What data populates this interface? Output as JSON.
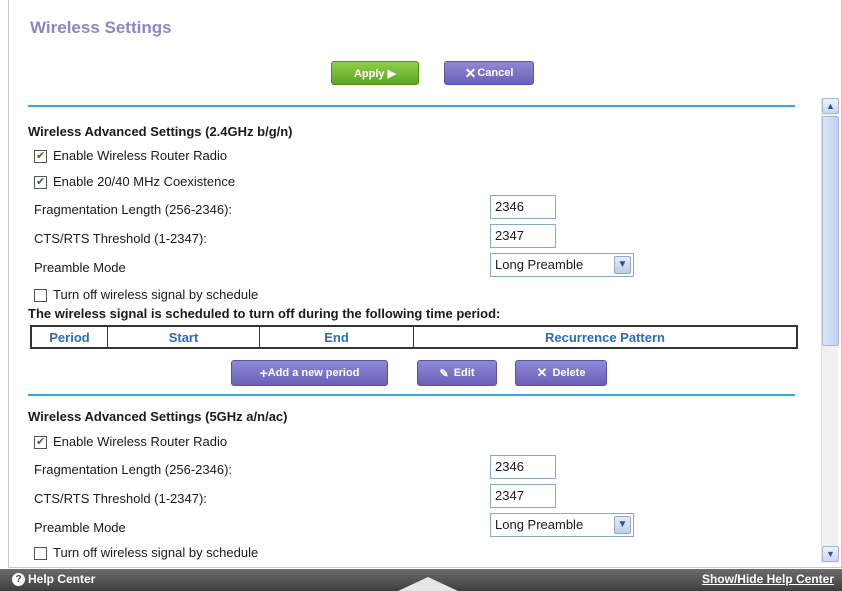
{
  "page": {
    "title": "Wireless Settings"
  },
  "toolbar": {
    "apply_label": "Apply ▶",
    "cancel_label": "Cancel"
  },
  "band24": {
    "title": "Wireless Advanced Settings (2.4GHz b/g/n)",
    "enable_radio": {
      "label": "Enable Wireless Router Radio",
      "checked": true
    },
    "coexistence": {
      "label": "Enable 20/40 MHz Coexistence",
      "checked": true
    },
    "frag": {
      "label": "Fragmentation Length (256-2346):",
      "value": "2346"
    },
    "cts": {
      "label": "CTS/RTS Threshold (1-2347):",
      "value": "2347"
    },
    "preamble": {
      "label": "Preamble Mode",
      "value": "Long Preamble"
    },
    "schedule": {
      "label": "Turn off wireless signal by schedule",
      "checked": false
    },
    "schedule_note": "The wireless signal is scheduled to turn off during the following time period:",
    "table_headers": [
      "Period",
      "Start",
      "End",
      "Recurrence Pattern"
    ],
    "add_period_label": "Add a new period",
    "edit_label": "Edit",
    "delete_label": "Delete"
  },
  "band5": {
    "title": "Wireless Advanced Settings (5GHz a/n/ac)",
    "enable_radio": {
      "label": "Enable Wireless Router Radio",
      "checked": true
    },
    "frag": {
      "label": "Fragmentation Length (256-2346):",
      "value": "2346"
    },
    "cts": {
      "label": "CTS/RTS Threshold (1-2347):",
      "value": "2347"
    },
    "preamble": {
      "label": "Preamble Mode",
      "value": "Long Preamble"
    },
    "schedule": {
      "label": "Turn off wireless signal by schedule",
      "checked": false
    }
  },
  "footer": {
    "help_label": "Help Center",
    "toggle_label": "Show/Hide Help Center"
  },
  "colors": {
    "title": "#8c87c3",
    "rule": "#38a9d6",
    "apply": "#6cb52b",
    "purple": "#7a72c8",
    "table_header": "#2a6db4"
  }
}
